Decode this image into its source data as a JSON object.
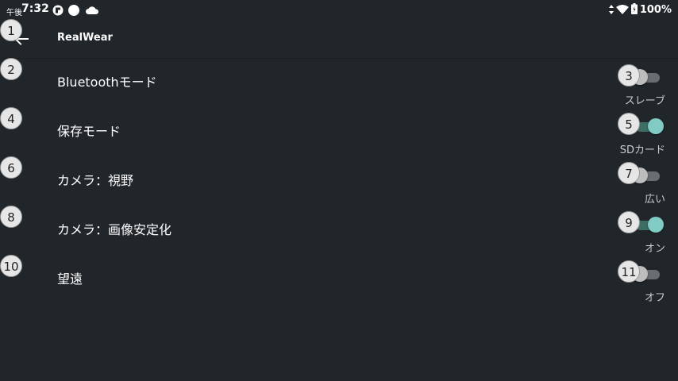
{
  "status_bar": {
    "time_prefix": "午後",
    "time": "7:32",
    "battery": "100%"
  },
  "app_bar": {
    "title": "RealWear"
  },
  "settings": [
    {
      "label": "Bluetoothモード",
      "state": "スレーブ",
      "on": false
    },
    {
      "label": "保存モード",
      "state": "SDカード",
      "on": true
    },
    {
      "label": "カメラ：視野",
      "state": "広い",
      "on": false
    },
    {
      "label": "カメラ：画像安定化",
      "state": "オン",
      "on": true
    },
    {
      "label": "望遠",
      "state": "オフ",
      "on": false
    }
  ],
  "badges": [
    "1",
    "2",
    "3",
    "4",
    "5",
    "6",
    "7",
    "8",
    "9",
    "10",
    "11"
  ],
  "colors": {
    "background": "#21262a",
    "toggle_on": "#80cbc4",
    "toggle_off": "#bdbdbd"
  },
  "icons": {
    "back": "arrow-left-icon",
    "wifi": "wifi-icon",
    "battery": "battery-icon"
  }
}
